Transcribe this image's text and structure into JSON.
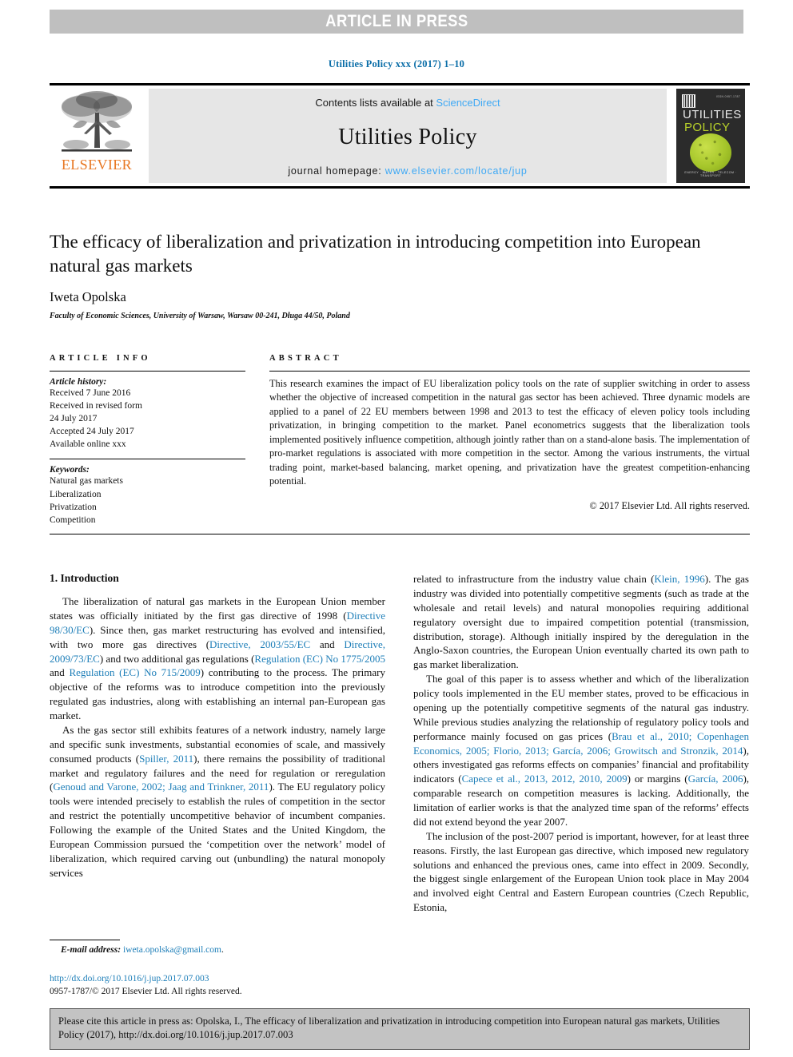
{
  "banner": {
    "press_label": "ARTICLE IN PRESS"
  },
  "journal_ref": "Utilities Policy xxx (2017) 1–10",
  "masthead": {
    "publisher_name": "ELSEVIER",
    "contents_prefix": "Contents lists available at ",
    "sciencedirect_label": "ScienceDirect",
    "journal_title": "Utilities Policy",
    "homepage_prefix": "journal homepage: ",
    "homepage_url": "www.elsevier.com/locate/jup",
    "cover": {
      "line1": "UTILITIES",
      "line2": "POLICY",
      "top_right": "ISSN 0957-1787",
      "bottom_strip": "ENERGY · WATER · TELECOM · TRANSPORT"
    }
  },
  "article": {
    "title": "The efficacy of liberalization and privatization in introducing competition into European natural gas markets",
    "author": "Iweta Opolska",
    "affiliation": "Faculty of Economic Sciences, University of Warsaw, Warsaw 00-241, Długa 44/50, Poland"
  },
  "article_info": {
    "heading": "ARTICLE INFO",
    "history_label": "Article history:",
    "history": [
      "Received 7 June 2016",
      "Received in revised form",
      "24 July 2017",
      "Accepted 24 July 2017",
      "Available online xxx"
    ],
    "keywords_label": "Keywords:",
    "keywords": [
      "Natural gas markets",
      "Liberalization",
      "Privatization",
      "Competition"
    ]
  },
  "abstract": {
    "heading": "ABSTRACT",
    "body": "This research examines the impact of EU liberalization policy tools on the rate of supplier switching in order to assess whether the objective of increased competition in the natural gas sector has been achieved. Three dynamic models are applied to a panel of 22 EU members between 1998 and 2013 to test the efficacy of eleven policy tools including privatization, in bringing competition to the market. Panel econometrics suggests that the liberalization tools implemented positively influence competition, although jointly rather than on a stand-alone basis. The implementation of pro-market regulations is associated with more competition in the sector. Among the various instruments, the virtual trading point, market-based balancing, market opening, and privatization have the greatest competition-enhancing potential.",
    "copyright": "© 2017 Elsevier Ltd. All rights reserved."
  },
  "body": {
    "section_heading": "1. Introduction",
    "left_paragraphs": [
      {
        "parts": [
          {
            "t": "The liberalization of natural gas markets in the European Union member states was officially initiated by the first gas directive of 1998 ("
          },
          {
            "t": "Directive 98/30/EC",
            "ref": true
          },
          {
            "t": "). Since then, gas market restructuring has evolved and intensified, with two more gas directives ("
          },
          {
            "t": "Directive, 2003/55/EC",
            "ref": true
          },
          {
            "t": " and "
          },
          {
            "t": "Directive, 2009/73/EC",
            "ref": true
          },
          {
            "t": ") and two additional gas regulations ("
          },
          {
            "t": "Regulation (EC) No 1775/2005",
            "ref": true
          },
          {
            "t": " and "
          },
          {
            "t": "Regulation (EC) No 715/2009",
            "ref": true
          },
          {
            "t": ") contributing to the process. The primary objective of the reforms was to introduce competition into the previously regulated gas industries, along with establishing an internal pan-European gas market."
          }
        ]
      },
      {
        "parts": [
          {
            "t": "As the gas sector still exhibits features of a network industry, namely large and specific sunk investments, substantial economies of scale, and massively consumed products ("
          },
          {
            "t": "Spiller, 2011",
            "ref": true
          },
          {
            "t": "), there remains the possibility of traditional market and regulatory failures and the need for regulation or reregulation ("
          },
          {
            "t": "Genoud and Varone, 2002; Jaag and Trinkner, 2011",
            "ref": true
          },
          {
            "t": "). The EU regulatory policy tools were intended precisely to establish the rules of competition in the sector and restrict the potentially uncompetitive behavior of incumbent companies. Following the example of the United States and the United Kingdom, the European Commission pursued the ‘competition over the network’ model of liberalization, which required carving out (unbundling) the natural monopoly services"
          }
        ]
      }
    ],
    "right_paragraphs": [
      {
        "continued": true,
        "parts": [
          {
            "t": "related to infrastructure from the industry value chain ("
          },
          {
            "t": "Klein, 1996",
            "ref": true
          },
          {
            "t": "). The gas industry was divided into potentially competitive segments (such as trade at the wholesale and retail levels) and natural monopolies requiring additional regulatory oversight due to impaired competition potential (transmission, distribution, storage). Although initially inspired by the deregulation in the Anglo-Saxon countries, the European Union eventually charted its own path to gas market liberalization."
          }
        ]
      },
      {
        "parts": [
          {
            "t": "The goal of this paper is to assess whether and which of the liberalization policy tools implemented in the EU member states, proved to be efficacious in opening up the potentially competitive segments of the natural gas industry. While previous studies analyzing the relationship of regulatory policy tools and performance mainly focused on gas prices ("
          },
          {
            "t": "Brau et al., 2010; Copenhagen Economics, 2005; Florio, 2013; García, 2006; Growitsch and Stronzik, 2014",
            "ref": true
          },
          {
            "t": "), others investigated gas reforms effects on companies’ financial and profitability indicators ("
          },
          {
            "t": "Capece et al., 2013, 2012, 2010, 2009",
            "ref": true
          },
          {
            "t": ") or margins ("
          },
          {
            "t": "García, 2006",
            "ref": true
          },
          {
            "t": "), comparable research on competition measures is lacking. Additionally, the limitation of earlier works is that the analyzed time span of the reforms’ effects did not extend beyond the year 2007."
          }
        ]
      },
      {
        "parts": [
          {
            "t": "The inclusion of the post-2007 period is important, however, for at least three reasons. Firstly, the last European gas directive, which imposed new regulatory solutions and enhanced the previous ones, came into effect in 2009. Secondly, the biggest single enlargement of the European Union took place in May 2004 and involved eight Central and Eastern European countries (Czech Republic, Estonia,"
          }
        ]
      }
    ]
  },
  "footer": {
    "email_label": "E-mail address:",
    "email": "iweta.opolska@gmail.com",
    "doi_url": "http://dx.doi.org/10.1016/j.jup.2017.07.003",
    "issn_line": "0957-1787/© 2017 Elsevier Ltd. All rights reserved."
  },
  "cite_box": {
    "text": "Please cite this article in press as: Opolska, I., The efficacy of liberalization and privatization in introducing competition into European natural gas markets, Utilities Policy (2017), http://dx.doi.org/10.1016/j.jup.2017.07.003"
  },
  "colors": {
    "link": "#1d7eb8",
    "sciencedirect": "#3fa9f5",
    "elsevier_orange": "#e87722",
    "banner_grey": "#bfbfbf",
    "cite_grey": "#c3c3c3"
  }
}
